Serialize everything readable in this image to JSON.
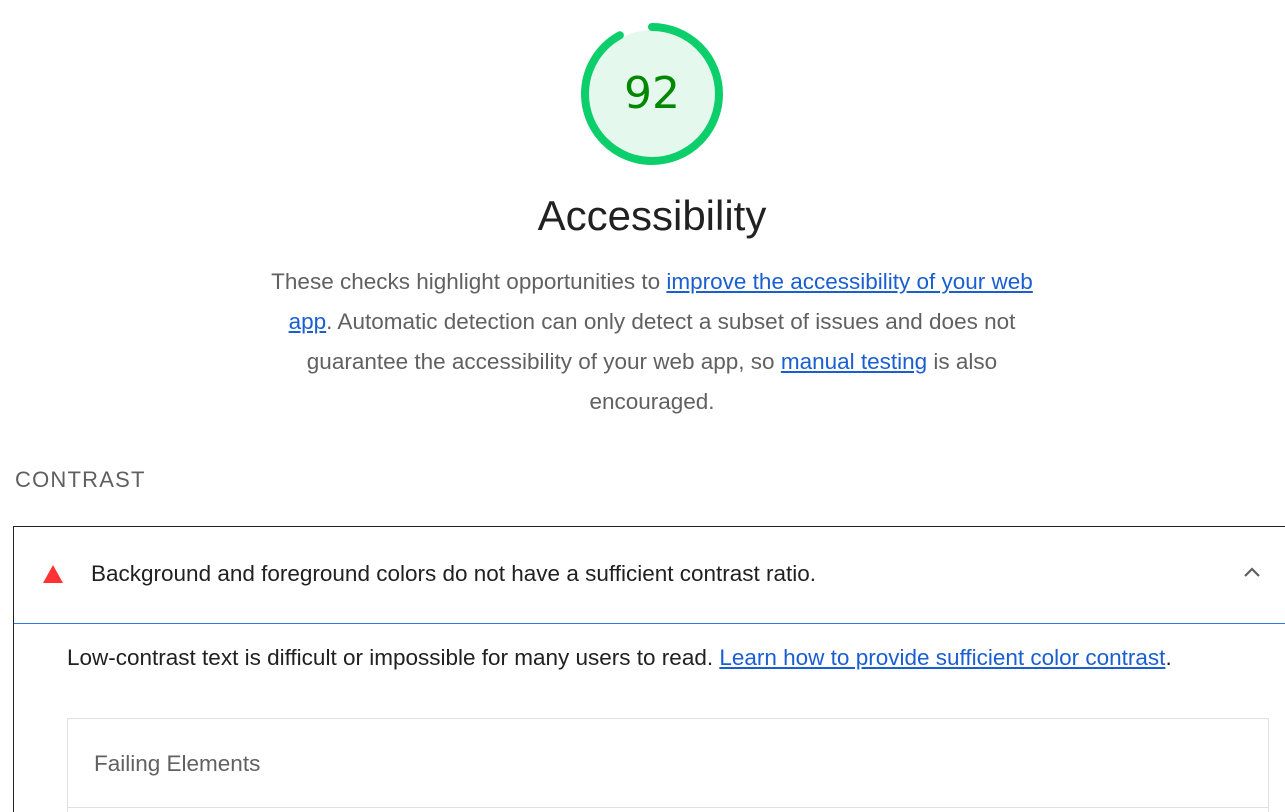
{
  "score": {
    "value": "92",
    "fraction": 0.92,
    "ring_color": "#0cce6b",
    "fill_color": "#e5f8ee",
    "text_color": "#008800"
  },
  "category": {
    "title": "Accessibility",
    "description_part1": "These checks highlight opportunities to ",
    "link1": "improve the accessibility of your web app",
    "description_part2": ". Automatic detection can only detect a subset of issues and does not guarantee the accessibility of your web app, so ",
    "link2": "manual testing",
    "description_part3": " is also encouraged."
  },
  "group": {
    "title": "CONTRAST"
  },
  "audit": {
    "status_icon": "fail-triangle-icon",
    "status_color": "#ff3333",
    "title": "Background and foreground colors do not have a sufficient contrast ratio.",
    "expand_icon": "chevron-up-icon",
    "description": "Low-contrast text is difficult or impossible for many users to read. ",
    "learn_link": "Learn how to provide sufficient color contrast",
    "description_end": ".",
    "failing_elements_title": "Failing Elements"
  }
}
